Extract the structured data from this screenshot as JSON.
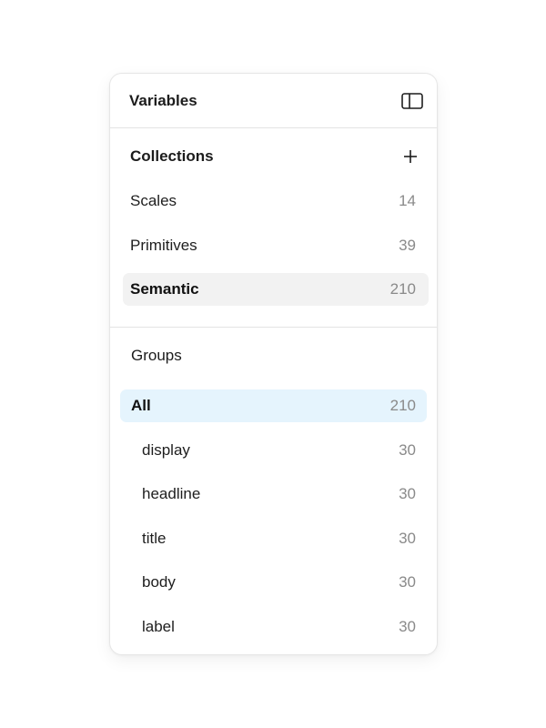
{
  "header": {
    "title": "Variables",
    "toggle_icon": "sidebar-toggle-icon"
  },
  "collections": {
    "title": "Collections",
    "add_icon": "plus-icon",
    "items": [
      {
        "label": "Scales",
        "count": "14"
      },
      {
        "label": "Primitives",
        "count": "39"
      },
      {
        "label": "Semantic",
        "count": "210",
        "selected": true
      }
    ]
  },
  "groups": {
    "title": "Groups",
    "items": [
      {
        "label": "All",
        "count": "210",
        "selected": true
      },
      {
        "label": "display",
        "count": "30"
      },
      {
        "label": "headline",
        "count": "30"
      },
      {
        "label": "title",
        "count": "30"
      },
      {
        "label": "body",
        "count": "30"
      },
      {
        "label": "label",
        "count": "30"
      }
    ]
  },
  "colors": {
    "selected_collection_bg": "#f2f2f2",
    "selected_group_bg": "#e5f4fd",
    "count_text": "#8a8a8a",
    "divider": "#e3e3e3"
  }
}
